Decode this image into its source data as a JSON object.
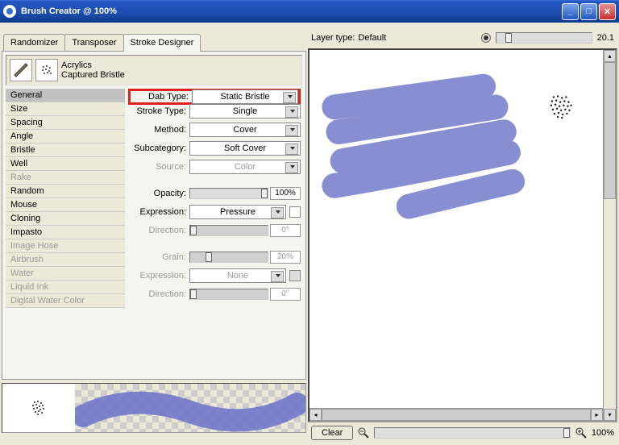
{
  "title": "Brush Creator @ 100%",
  "tabs": {
    "randomizer": "Randomizer",
    "transposer": "Transposer",
    "stroke_designer": "Stroke Designer"
  },
  "brush": {
    "category": "Acrylics",
    "variant": "Captured Bristle"
  },
  "categories": [
    {
      "label": "General",
      "state": "selected"
    },
    {
      "label": "Size",
      "state": ""
    },
    {
      "label": "Spacing",
      "state": ""
    },
    {
      "label": "Angle",
      "state": ""
    },
    {
      "label": "Bristle",
      "state": ""
    },
    {
      "label": "Well",
      "state": ""
    },
    {
      "label": "Rake",
      "state": "disabled"
    },
    {
      "label": "Random",
      "state": ""
    },
    {
      "label": "Mouse",
      "state": ""
    },
    {
      "label": "Cloning",
      "state": ""
    },
    {
      "label": "Impasto",
      "state": ""
    },
    {
      "label": "Image Hose",
      "state": "disabled"
    },
    {
      "label": "Airbrush",
      "state": "disabled"
    },
    {
      "label": "Water",
      "state": "disabled"
    },
    {
      "label": "Liquid Ink",
      "state": "disabled"
    },
    {
      "label": "Digital Water Color",
      "state": "disabled"
    }
  ],
  "settings": {
    "dab_type": {
      "label": "Dab Type:",
      "value": "Static Bristle"
    },
    "stroke_type": {
      "label": "Stroke Type:",
      "value": "Single"
    },
    "method": {
      "label": "Method:",
      "value": "Cover"
    },
    "subcategory": {
      "label": "Subcategory:",
      "value": "Soft Cover"
    },
    "source": {
      "label": "Source:",
      "value": "Color"
    },
    "opacity": {
      "label": "Opacity:",
      "value": "100%"
    },
    "expression1": {
      "label": "Expression:",
      "value": "Pressure"
    },
    "direction1": {
      "label": "Direction:",
      "value": "0°"
    },
    "grain": {
      "label": "Grain:",
      "value": "20%"
    },
    "expression2": {
      "label": "Expression:",
      "value": "None"
    },
    "direction2": {
      "label": "Direction:",
      "value": "0°"
    }
  },
  "layer": {
    "label": "Layer type:",
    "value": "Default",
    "size": "20.1"
  },
  "bottom": {
    "clear": "Clear",
    "zoom": "100%"
  }
}
